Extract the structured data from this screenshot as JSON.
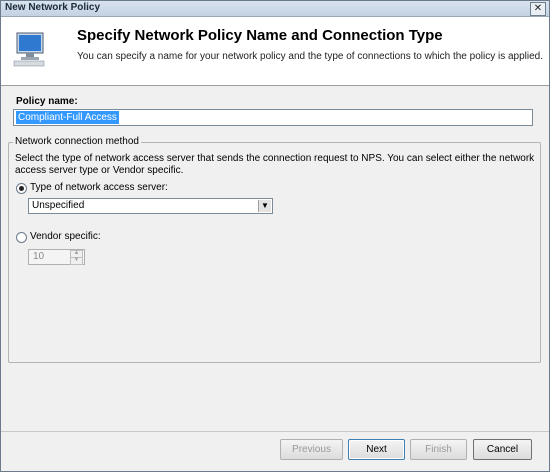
{
  "window": {
    "title": "New Network Policy"
  },
  "header": {
    "title": "Specify Network Policy Name and Connection Type",
    "subtitle": "You can specify a name for your network policy and the type of connections to which the policy is applied.",
    "icon": "computer-monitor-icon"
  },
  "policy": {
    "label": "Policy name:",
    "value": "Compliant-Full Access"
  },
  "connection_method": {
    "legend": "Network connection method",
    "description": "Select the type of network access server that sends the connection request to NPS. You can select either the network access server type or Vendor specific.",
    "type_label": "Type of network access server:",
    "type_value": "Unspecified",
    "vendor_label": "Vendor specific:",
    "vendor_value": "10"
  },
  "buttons": {
    "previous": "Previous",
    "next": "Next",
    "finish": "Finish",
    "cancel": "Cancel"
  }
}
